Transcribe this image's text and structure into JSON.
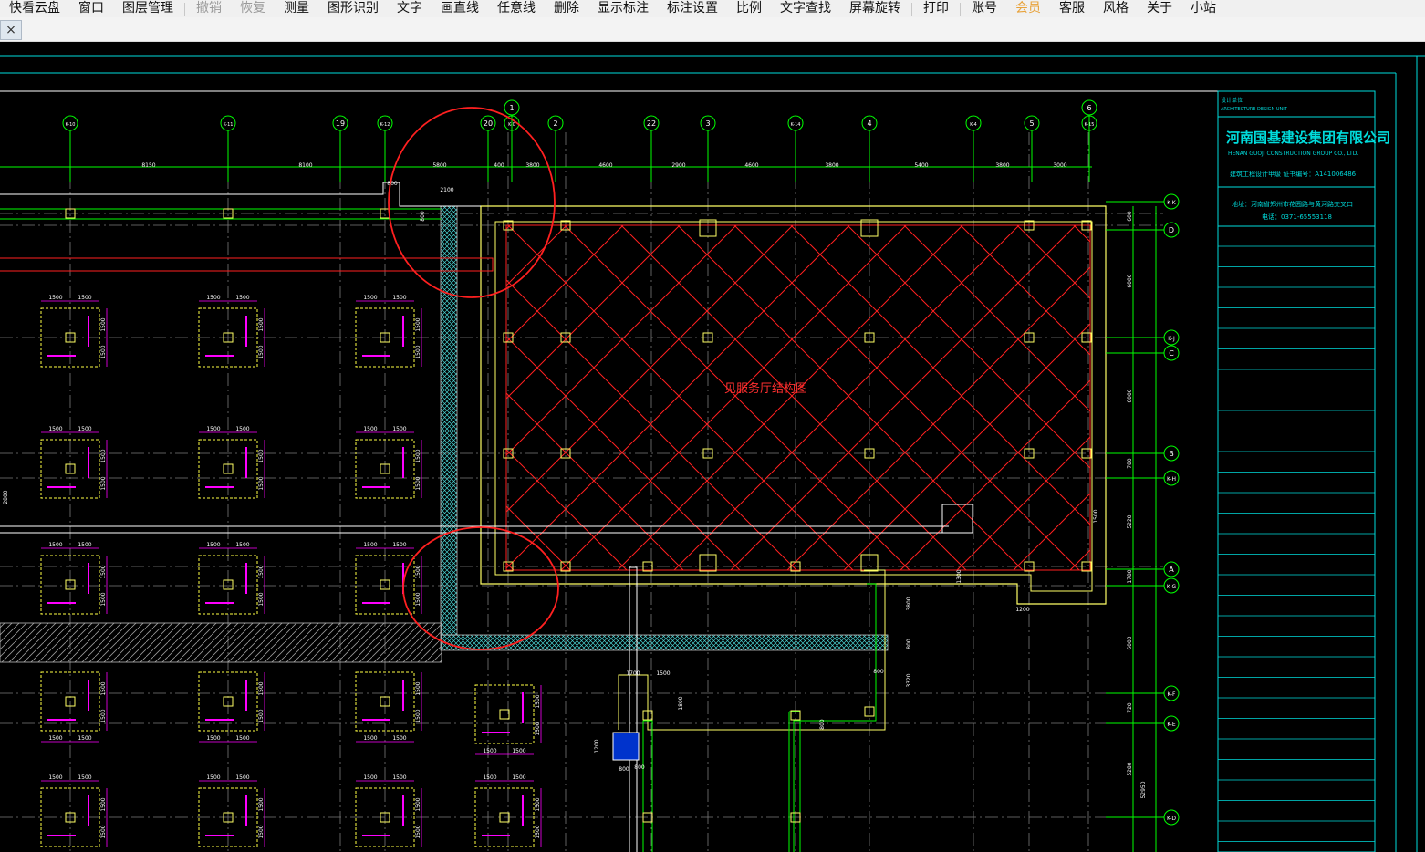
{
  "menu": [
    {
      "label": "快看云盘",
      "state": "normal"
    },
    {
      "label": "窗口",
      "state": "normal"
    },
    {
      "label": "图层管理",
      "state": "normal"
    },
    {
      "label": "撤销",
      "state": "disabled"
    },
    {
      "label": "恢复",
      "state": "disabled"
    },
    {
      "label": "测量",
      "state": "normal"
    },
    {
      "label": "图形识别",
      "state": "normal"
    },
    {
      "label": "文字",
      "state": "normal"
    },
    {
      "label": "画直线",
      "state": "normal"
    },
    {
      "label": "任意线",
      "state": "normal"
    },
    {
      "label": "删除",
      "state": "normal"
    },
    {
      "label": "显示标注",
      "state": "normal"
    },
    {
      "label": "标注设置",
      "state": "normal"
    },
    {
      "label": "比例",
      "state": "normal"
    },
    {
      "label": "文字查找",
      "state": "normal"
    },
    {
      "label": "屏幕旋转",
      "state": "normal"
    },
    {
      "label": "打印",
      "state": "normal"
    },
    {
      "label": "账号",
      "state": "normal"
    },
    {
      "label": "会员",
      "state": "vip"
    },
    {
      "label": "客服",
      "state": "normal"
    },
    {
      "label": "风格",
      "state": "normal"
    },
    {
      "label": "关于",
      "state": "normal"
    },
    {
      "label": "小站",
      "state": "normal"
    }
  ],
  "tab": {
    "close_glyph": "×"
  },
  "colors": {
    "background": "#000000",
    "grid_green": "#00ff00",
    "axis_gray": "#8a8a8a",
    "magenta": "#ff00ff",
    "yellow": "#ffff66",
    "red": "#ff3030",
    "cyan": "#00e0e0",
    "white": "#ffffff"
  },
  "drawing": {
    "axis_top": [
      "K-10",
      "K-11",
      "19",
      "K-12",
      "20",
      "K-0",
      "1",
      "2",
      "22",
      "3",
      "K-14",
      "4",
      "K-4",
      "5",
      "K-15",
      "6"
    ],
    "axis_right": [
      "K-K",
      "D",
      "K-J",
      "C",
      "B",
      "K-H",
      "A",
      "K-G",
      "K-F",
      "K-E",
      "K-D"
    ],
    "top_dims": [
      "8150",
      "8100",
      "5800",
      "400",
      "3800",
      "4600",
      "2900",
      "4600",
      "3800",
      "5400",
      "3800",
      "3000"
    ],
    "right_dims": [
      "600",
      "6000",
      "6000",
      "780",
      "5220",
      "1780",
      "6000",
      "720",
      "5280",
      "52950"
    ],
    "misc_dims": [
      "800",
      "2100",
      "800",
      "2800",
      "3800",
      "800",
      "3320",
      "800",
      "800",
      "1300",
      "1700",
      "1500",
      "1800",
      "1200",
      "800",
      "800",
      "1200",
      "1500"
    ],
    "footing_dim": "1500",
    "center_label": "见服务厅结构图",
    "footing_tag": "独立基础",
    "title_block": {
      "design_unit_cn": "设计单位",
      "design_unit_en": "ARCHITECTURE DESIGN UNIT",
      "company_cn": "河南国基建设集团有限公司",
      "company_en": "HENAN GUOJI CONSTRUCTION GROUP CO., LTD.",
      "qualification": "建筑工程设计甲级   证书编号：A141006486",
      "address": "地址：河南省郑州市花园路与黄河路交叉口",
      "phone": "电话：0371-65553118"
    }
  }
}
